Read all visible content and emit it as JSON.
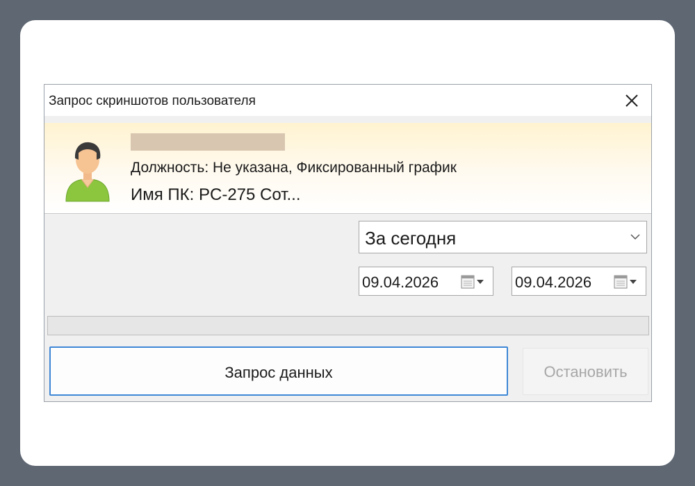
{
  "window": {
    "title": "Запрос скриншотов пользователя"
  },
  "user": {
    "position_line": "Должность: Не указана, Фиксированный график",
    "pc_line": "Имя ПК: PC-275 Сот..."
  },
  "period": {
    "selected": "За сегодня"
  },
  "dates": {
    "from": "09.04.2026",
    "to": "09.04.2026"
  },
  "progress": {
    "value": 0
  },
  "buttons": {
    "request_label": "Запрос данных",
    "stop_label": "Остановить",
    "stop_enabled": false
  },
  "icons": {
    "close": "close-icon",
    "avatar": "user-avatar-icon",
    "period_dropdown": "chevron-down-icon",
    "date_picker": "calendar-icon"
  },
  "colors": {
    "backdrop": "#5f6773",
    "header_gradient_top": "#fff3d0",
    "request_button_border": "#3d86d6",
    "disabled_text": "#a6a6a6",
    "name_redaction": "#d8c6b1"
  }
}
